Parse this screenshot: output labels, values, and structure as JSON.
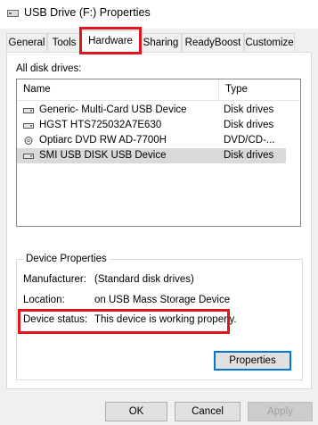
{
  "window": {
    "title": "USB Drive (F:) Properties"
  },
  "tabs": [
    "General",
    "Tools",
    "Hardware",
    "Sharing",
    "ReadyBoost",
    "Customize"
  ],
  "active_tab": "Hardware",
  "all_disk_drives_label": "All disk drives:",
  "columns": {
    "name": "Name",
    "type": "Type"
  },
  "drives": [
    {
      "name": "Generic- Multi-Card USB Device",
      "type": "Disk drives",
      "icon": "disk-drive-icon"
    },
    {
      "name": "HGST HTS725032A7E630",
      "type": "Disk drives",
      "icon": "disk-drive-icon"
    },
    {
      "name": "Optiarc DVD RW AD-7700H",
      "type": "DVD/CD-...",
      "icon": "dvd-drive-icon"
    },
    {
      "name": "SMI USB DISK USB Device",
      "type": "Disk drives",
      "icon": "disk-drive-icon",
      "selected": true
    }
  ],
  "device_properties": {
    "title": "Device Properties",
    "manufacturer_label": "Manufacturer:",
    "manufacturer_value": "(Standard disk drives)",
    "location_label": "Location:",
    "location_value": "on USB Mass Storage Device",
    "status_label": "Device status:",
    "status_value": "This device is working properly.",
    "properties_button": "Properties"
  },
  "buttons": {
    "ok": "OK",
    "cancel": "Cancel",
    "apply": "Apply"
  },
  "colors": {
    "highlight_red": "#e0141e",
    "focus_blue": "#0078d7",
    "selected_row": "#d9d9d9"
  }
}
